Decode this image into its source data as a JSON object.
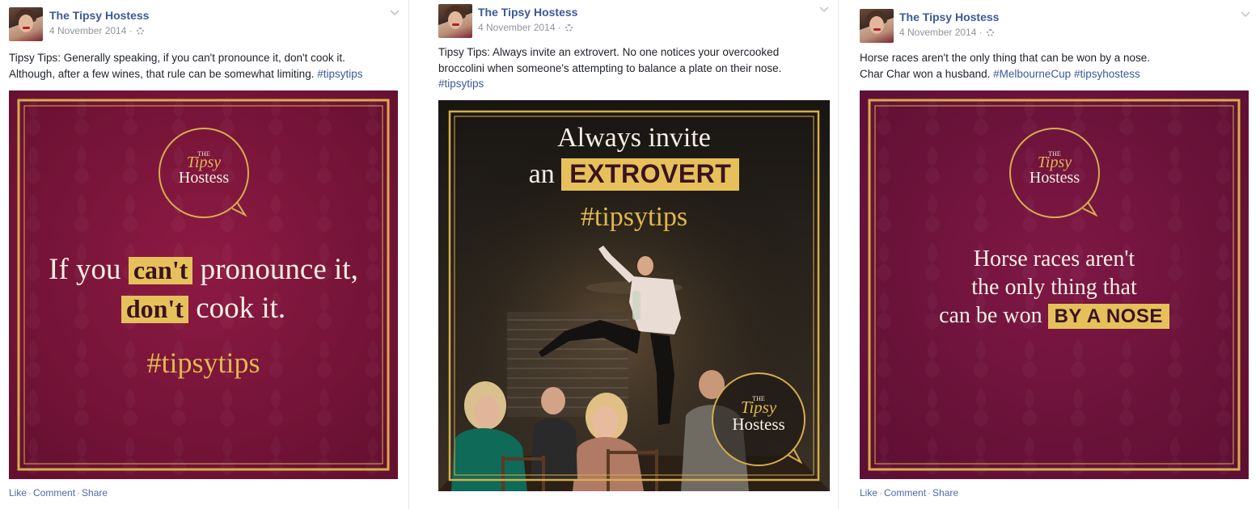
{
  "posts": [
    {
      "author": "The Tipsy Hostess",
      "date": "4 November 2014",
      "caption_lines": [
        [
          {
            "t": "Tipsy Tips: Generally speaking, if you can't pronounce it, don't cook it."
          }
        ],
        [
          {
            "t": "Although, after a few wines, that rule can be somewhat limiting. "
          },
          {
            "t": "#tipsytips",
            "link": true
          }
        ]
      ],
      "image": {
        "logo_the": "THE",
        "logo_tipsy": "Tipsy",
        "logo_hostess": "Hostess",
        "line1_pre": "If you",
        "line1_hl": "can't",
        "line1_post": "pronounce it,",
        "line2_hl": "don't",
        "line2_post": "cook it.",
        "hashtag": "#tipsytips"
      },
      "actions": [
        "Like",
        "Comment",
        "Share"
      ]
    },
    {
      "author": "The Tipsy Hostess",
      "date": "4 November 2014",
      "caption_lines": [
        [
          {
            "t": "Tipsy Tips: Always invite an extrovert. No one notices your overcooked"
          }
        ],
        [
          {
            "t": "broccolini when someone's attempting to balance a plate on their nose."
          }
        ],
        [
          {
            "t": "#tipsytips",
            "link": true
          }
        ]
      ],
      "image": {
        "line1": "Always invite",
        "line2_pre": "an",
        "line2_hl": "EXTROVERT",
        "hashtag": "#tipsytips",
        "logo_the": "THE",
        "logo_tipsy": "Tipsy",
        "logo_hostess": "Hostess"
      },
      "actions": []
    },
    {
      "author": "The Tipsy Hostess",
      "date": "4 November 2014",
      "caption_lines": [
        [
          {
            "t": "Horse races aren't the only thing that can be won by a nose."
          }
        ],
        [
          {
            "t": "Char Char won a husband. "
          },
          {
            "t": "#MelbourneCup",
            "link": true
          },
          {
            "t": " "
          },
          {
            "t": "#tipsyhostess",
            "link": true
          }
        ]
      ],
      "image": {
        "logo_the": "THE",
        "logo_tipsy": "Tipsy",
        "logo_hostess": "Hostess",
        "line1": "Horse races aren't",
        "line2": "the only thing that",
        "line3_pre": "can be won",
        "line3_hl": "BY A NOSE"
      },
      "actions": [
        "Like",
        "Comment",
        "Share"
      ]
    }
  ],
  "colors": {
    "link": "#3b5998",
    "burgundy": "#7e1538",
    "gold": "#e0b84e",
    "highlight": "#e6c15b"
  }
}
